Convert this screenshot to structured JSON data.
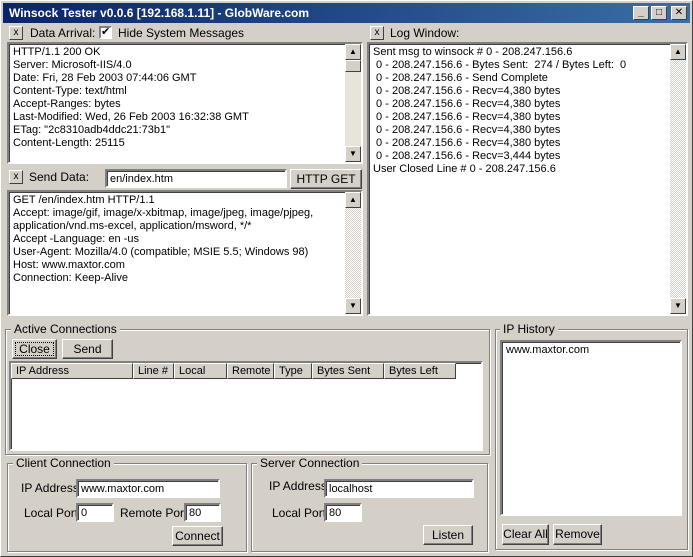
{
  "window": {
    "title": "Winsock Tester v0.0.6  [192.168.1.11] - GlobWare.com",
    "minimize": "_",
    "maximize": "□",
    "close": "✕"
  },
  "data_arrival": {
    "clear_label": "x",
    "label": "Data Arrival:",
    "hide_checked": "✔",
    "hide_label": "Hide System Messages",
    "lines": [
      "HTTP/1.1 200 OK",
      "Server: Microsoft-IIS/4.0",
      "Date: Fri, 28 Feb 2003 07:44:06 GMT",
      "Content-Type: text/html",
      "Accept-Ranges: bytes",
      "Last-Modified: Wed, 26 Feb 2003 16:32:38 GMT",
      "ETag: \"2c8310adb4ddc21:73b1\"",
      "Content-Length: 25115"
    ]
  },
  "send_data": {
    "clear_label": "x",
    "label": "Send Data:",
    "value": "en/index.htm",
    "http_get_label": "HTTP GET",
    "lines": [
      "GET /en/index.htm HTTP/1.1",
      "Accept: image/gif, image/x-xbitmap, image/jpeg, image/pjpeg,",
      "application/vnd.ms-excel, application/msword, */*",
      "Accept -Language: en -us",
      "User-Agent: Mozilla/4.0 (compatible; MSIE 5.5; Windows 98)",
      "Host: www.maxtor.com",
      "Connection: Keep-Alive"
    ]
  },
  "log_window": {
    "clear_label": "x",
    "label": "Log Window:",
    "lines": [
      "Sent msg to winsock # 0 - 208.247.156.6",
      " 0 - 208.247.156.6 - Bytes Sent:  274 / Bytes Left:  0",
      " 0 - 208.247.156.6 - Send Complete",
      " 0 - 208.247.156.6 - Recv=4,380 bytes",
      " 0 - 208.247.156.6 - Recv=4,380 bytes",
      " 0 - 208.247.156.6 - Recv=4,380 bytes",
      " 0 - 208.247.156.6 - Recv=4,380 bytes",
      " 0 - 208.247.156.6 - Recv=4,380 bytes",
      " 0 - 208.247.156.6 - Recv=3,444 bytes",
      "User Closed Line # 0 - 208.247.156.6"
    ]
  },
  "active_connections": {
    "title": "Active Connections",
    "close_label": "Close",
    "send_label": "Send",
    "columns": [
      "IP Address",
      "Line #",
      "Local",
      "Remote",
      "Type",
      "Bytes Sent",
      "Bytes Left"
    ]
  },
  "client_connection": {
    "title": "Client Connection",
    "ip_label": "IP Address",
    "ip_value": "www.maxtor.com",
    "local_port_label": "Local Port",
    "local_port_value": "0",
    "remote_port_label": "Remote Port",
    "remote_port_value": "80",
    "connect_label": "Connect"
  },
  "server_connection": {
    "title": "Server Connection",
    "ip_label": "IP Address",
    "ip_value": "localhost",
    "local_port_label": "Local Port",
    "local_port_value": "80",
    "listen_label": "Listen"
  },
  "ip_history": {
    "title": "IP History",
    "items": [
      "www.maxtor.com"
    ],
    "clear_all_label": "Clear All",
    "remove_label": "Remove"
  }
}
